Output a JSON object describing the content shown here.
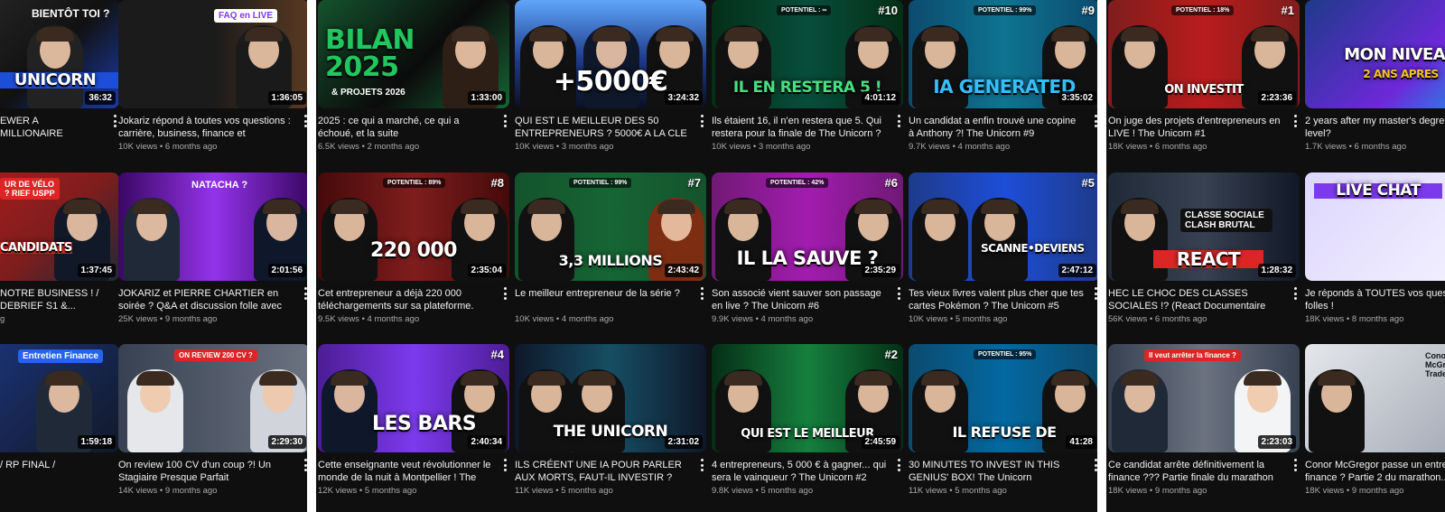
{
  "colors": {
    "background": "#0f0f0f",
    "meta_text": "#aaaaaa",
    "title_text": "#f1f1f1"
  },
  "left_panel": {
    "rows": [
      [
        {
          "title": "EWER A MILLIONAIRE\nONCEPT",
          "meta": "",
          "duration": "36:32",
          "thumb_text": "UNICORN",
          "badge": "BIENTÔT TOI ?",
          "episode": ""
        },
        {
          "title": "Jokariz répond à toutes vos questions : carrière, business, finance et nouveaux...",
          "meta": "10K views • 6 months ago",
          "duration": "1:36:05",
          "thumb_text": "",
          "badge": "FAQ en LIVE",
          "episode": ""
        }
      ],
      [
        {
          "title": "NOTRE BUSINESS ! / DEBRIEF S1 &...",
          "meta": "g",
          "duration": "1:37:45",
          "thumb_text": "CANDIDATS",
          "badge": "UR DE VÉLO ? RIEF USPP",
          "episode": ""
        },
        {
          "title": "JOKARIZ et PIERRE CHARTIER en soirée ? Q&A et discussion folle avec Ziyad",
          "meta": "25K views • 9 months ago",
          "duration": "2:01:56",
          "thumb_text": "",
          "badge": "NATACHA ?",
          "episode": ""
        }
      ],
      [
        {
          "title": "/ RP FINAL /",
          "meta": "",
          "duration": "1:59:18",
          "thumb_text": "",
          "badge": "Entretien Finance",
          "episode": ""
        },
        {
          "title": "On review 100 CV d'un coup ?! Un Stagiaire Presque Parfait",
          "meta": "14K views • 9 months ago",
          "duration": "2:29:30",
          "thumb_text": "",
          "badge": "ON REVIEW 200 CV ?",
          "episode": ""
        }
      ]
    ]
  },
  "center_panel": {
    "rows": [
      [
        {
          "title": "2025 : ce qui a marché, ce qui a échoué, et la suite",
          "meta": "6.5K views • 2 months ago",
          "duration": "1:33:00",
          "thumb_text": "BILAN 2025",
          "badge": "& PROJETS 2026",
          "episode": ""
        },
        {
          "title": "QUI EST LE MEILLEUR DES 50 ENTREPRENEURS ? 5000€ A LA CLE",
          "meta": "10K views • 3 months ago",
          "duration": "3:24:32",
          "thumb_text": "+5000€",
          "badge": "",
          "episode": ""
        },
        {
          "title": "Ils étaient 16, il n'en restera que 5. Qui restera pour la finale de The Unicorn ?",
          "meta": "10K views • 3 months ago",
          "duration": "4:01:12",
          "thumb_text": "IL EN RESTERA 5 !",
          "badge": "POTENTIEL : ∞",
          "episode": "#10"
        },
        {
          "title": "Un candidat a enfin trouvé une copine à Anthony ?! The Unicorn #9",
          "meta": "9.7K views • 4 months ago",
          "duration": "3:35:02",
          "thumb_text": "IA GENERATED",
          "badge": "POTENTIEL : 99%",
          "episode": "#9"
        }
      ],
      [
        {
          "title": "Cet entrepreneur a déjà 220 000 téléchargements sur sa plateforme. The...",
          "meta": "9.5K views • 4 months ago",
          "duration": "2:35:04",
          "thumb_text": "220 000",
          "badge": "POTENTIEL : 89%",
          "episode": "#8"
        },
        {
          "title": "Le meilleur entrepreneur de la série ?",
          "meta": "10K views • 4 months ago",
          "duration": "2:43:42",
          "thumb_text": "3,3 MILLIONS",
          "badge": "POTENTIEL : 99%",
          "episode": "#7"
        },
        {
          "title": "Son associé vient sauver son passage en live ? The Unicorn #6",
          "meta": "9.9K views • 4 months ago",
          "duration": "2:35:29",
          "thumb_text": "IL LA SAUVE ?",
          "badge": "POTENTIEL : 42%",
          "episode": "#6"
        },
        {
          "title": "Tes vieux livres valent plus cher que tes cartes Pokémon ? The Unicorn #5",
          "meta": "10K views • 5 months ago",
          "duration": "2:47:12",
          "thumb_text": "SCANNE•DEVIENS",
          "badge": "",
          "episode": "#5"
        }
      ],
      [
        {
          "title": "Cette enseignante veut révolutionner le monde de la nuit à Montpellier ! The Unicor...",
          "meta": "12K views • 5 months ago",
          "duration": "2:40:34",
          "thumb_text": "LES BARS",
          "badge": "",
          "episode": "#4"
        },
        {
          "title": "ILS CRÉENT UNE IA POUR PARLER AUX MORTS, FAUT-IL INVESTIR ? The Unicorn #3",
          "meta": "11K views • 5 months ago",
          "duration": "2:31:02",
          "thumb_text": "THE UNICORN",
          "badge": "",
          "episode": ""
        },
        {
          "title": "4 entrepreneurs, 5 000 € à gagner... qui sera le vainqueur ? The Unicorn #2",
          "meta": "9.8K views • 5 months ago",
          "duration": "2:45:59",
          "thumb_text": "QUI EST LE MEILLEUR",
          "badge": "",
          "episode": "#2"
        },
        {
          "title": "30 MINUTES TO INVEST IN THIS GENIUS' BOX! The Unicorn",
          "meta": "11K views • 5 months ago",
          "duration": "41:28",
          "thumb_text": "IL REFUSE DE",
          "badge": "POTENTIEL : 95%",
          "episode": ""
        }
      ]
    ]
  },
  "right_panel": {
    "rows": [
      [
        {
          "title": "On juge des projets d'entrepreneurs en LIVE ! The Unicorn #1",
          "meta": "18K views • 6 months ago",
          "duration": "2:23:36",
          "thumb_text": "ON INVESTIT",
          "badge": "POTENTIEL : 18%",
          "episode": "#1"
        },
        {
          "title": "2 years after my master's degree real level?",
          "meta": "1.7K views • 6 months ago",
          "duration": "",
          "thumb_text": "MON NIVEAU",
          "badge": "2 ANS APRES",
          "episode": ""
        }
      ],
      [
        {
          "title": "HEC LE CHOC DES CLASSES SOCIALES !? (React Documentaire Arte)",
          "meta": "56K views • 6 months ago",
          "duration": "1:28:32",
          "thumb_text": "REACT",
          "badge": "CLASSE SOCIALE CLASH BRUTAL",
          "episode": ""
        },
        {
          "title": "Je réponds à TOUTES vos questions folles !",
          "meta": "18K views • 8 months ago",
          "duration": "",
          "thumb_text": "LIVE CHAT",
          "badge": "",
          "episode": ""
        }
      ],
      [
        {
          "title": "Ce candidat arrête définitivement la finance ??? Partie finale du marathon d'entretiens !",
          "meta": "18K views • 9 months ago",
          "duration": "2:23:03",
          "thumb_text": "",
          "badge": "Il veut arrêter la finance ?",
          "episode": ""
        },
        {
          "title": "Conor McGregor passe un entretien finance ? Partie 2 du marathon...",
          "meta": "18K views • 9 months ago",
          "duration": "",
          "thumb_text": "",
          "badge": "Conor McGregor Trader???",
          "episode": ""
        }
      ]
    ]
  }
}
